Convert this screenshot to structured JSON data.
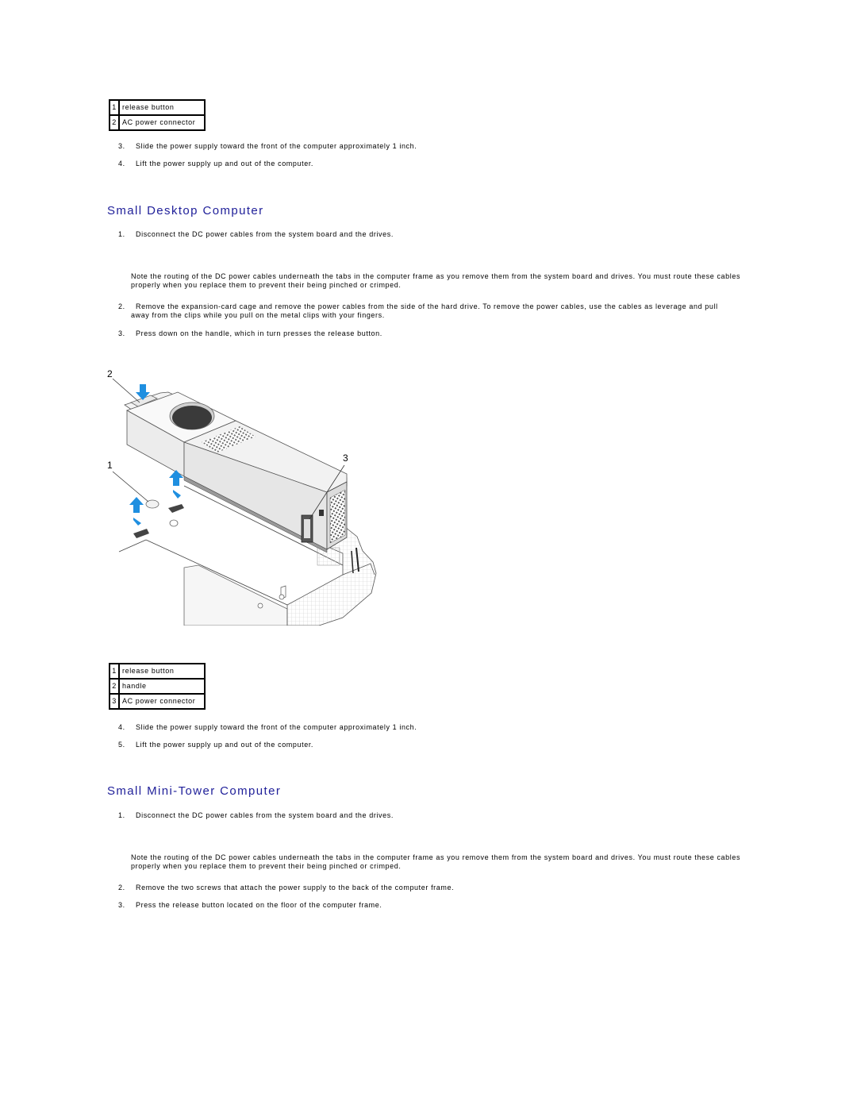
{
  "section_top": {
    "legend": [
      {
        "num": "1",
        "label": "release button"
      },
      {
        "num": "2",
        "label": "AC power connector"
      }
    ],
    "steps": [
      {
        "num": "3.",
        "text": "Slide the power supply toward the front of the computer approximately 1 inch."
      },
      {
        "num": "4.",
        "text": "Lift the power supply up and out of the computer."
      }
    ]
  },
  "small_desktop": {
    "heading": "Small Desktop Computer",
    "step1": {
      "num": "1.",
      "text": "Disconnect the DC power cables from the system board and the drives."
    },
    "note": "Note the routing of the DC power cables underneath the tabs in the computer frame as you remove them from the system board and drives. You must route these cables properly when you replace them to prevent their being pinched or crimped.",
    "step2": {
      "num": "2.",
      "text": "Remove the expansion-card cage and remove the power cables from the side of the hard drive. To remove the power cables, use the cables as leverage and pull away from the clips while you pull on the metal clips with your fingers."
    },
    "step3": {
      "num": "3.",
      "text": "Press down on the handle, which in turn presses the release button."
    },
    "figure": {
      "callouts": [
        "1",
        "2",
        "3"
      ],
      "accent_color": "#1f8fe0"
    },
    "legend": [
      {
        "num": "1",
        "label": "release button"
      },
      {
        "num": "2",
        "label": "handle"
      },
      {
        "num": "3",
        "label": "AC power connector"
      }
    ],
    "step4": {
      "num": "4.",
      "text": "Slide the power supply toward the front of the computer approximately 1 inch."
    },
    "step5": {
      "num": "5.",
      "text": "Lift the power supply up and out of the computer."
    }
  },
  "small_minitower": {
    "heading": "Small Mini-Tower Computer",
    "step1": {
      "num": "1.",
      "text": "Disconnect the DC power cables from the system board and the drives."
    },
    "note": "Note the routing of the DC power cables underneath the tabs in the computer frame as you remove them from the system board and drives. You must route these cables properly when you replace them to prevent their being pinched or crimped.",
    "step2": {
      "num": "2.",
      "text": "Remove the two screws that attach the power supply to the back of the computer frame."
    },
    "step3": {
      "num": "3.",
      "text": "Press the release button located on the floor of the computer frame."
    }
  }
}
